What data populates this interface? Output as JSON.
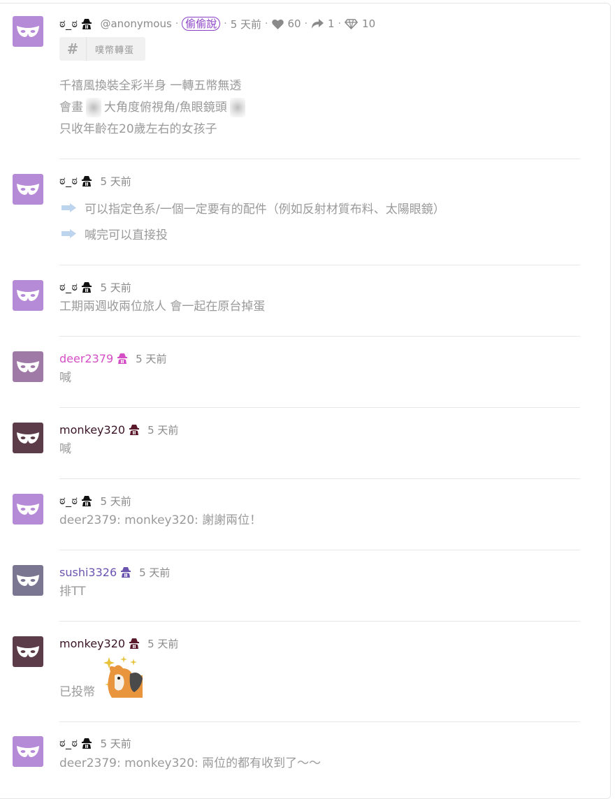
{
  "colors": {
    "avatar_purple": "#b58ad6",
    "avatar_dark": "#5b3c48",
    "avatar_grey": "#7a7590",
    "deer_pink": "#d44fc6",
    "sushi_purple": "#6b53b0",
    "monkey_maroon": "#3a1426",
    "pill_purple": "#8a3ec6"
  },
  "op": {
    "username": "ಠ_ಠ",
    "handle": "@anonymous",
    "category": "偷偷說",
    "time": "5 天前",
    "likes": "60",
    "shares": "1",
    "diamonds": "10",
    "tag": "噗幣轉蛋",
    "lines": [
      "千禧風換裝全彩半身 一轉五幣無透",
      "大角度俯視角/魚眼鏡頭",
      "只收年齡在20歲左右的女孩子"
    ],
    "line2_prefix": "會畫"
  },
  "replies": [
    {
      "user": "ಠ_ಠ",
      "time": "5 天前",
      "bullets": [
        "可以指定色系/一個一定要有的配件（例如反射材質布料、太陽眼鏡）",
        "喊完可以直接投"
      ]
    },
    {
      "user": "ಠ_ಠ",
      "time": "5 天前",
      "text": "工期兩週收兩位旅人 會一起在原台掉蛋"
    },
    {
      "user": "deer2379",
      "time": "5 天前",
      "text": "喊"
    },
    {
      "user": "monkey320",
      "time": "5 天前",
      "text": "喊"
    },
    {
      "user": "ಠ_ಠ",
      "time": "5 天前",
      "text": "deer2379: monkey320: 謝謝兩位！"
    },
    {
      "user": "sushi3326",
      "time": "5 天前",
      "text": "排TT"
    },
    {
      "user": "monkey320",
      "time": "5 天前",
      "text": "已投幣"
    },
    {
      "user": "ಠ_ಠ",
      "time": "5 天前",
      "text": "deer2379: monkey320: 兩位的都有收到了～～"
    }
  ]
}
